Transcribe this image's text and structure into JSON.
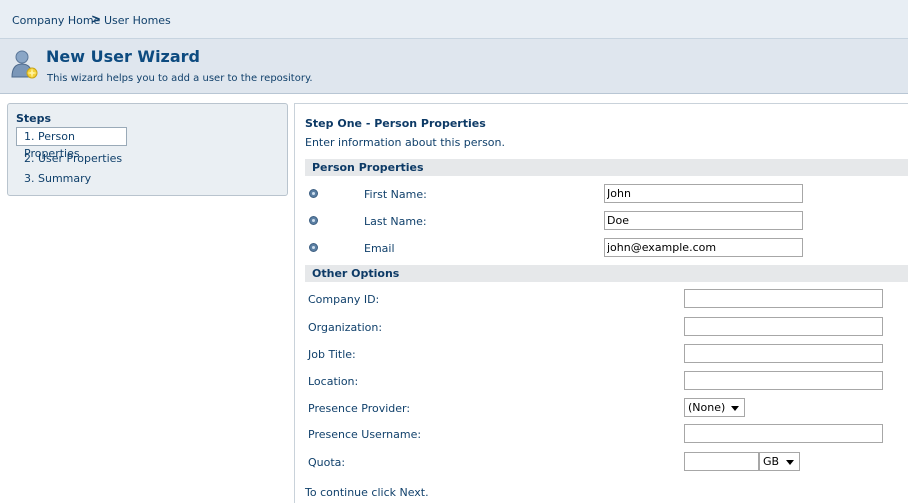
{
  "breadcrumb": {
    "home": "Company Home",
    "separator": ">",
    "current": "User Homes"
  },
  "header": {
    "title": "New User Wizard",
    "subtitle": "This wizard helps you to add a user to the repository."
  },
  "sidebar": {
    "title": "Steps",
    "items": [
      {
        "label": "1. Person Properties"
      },
      {
        "label": "2. User Properties"
      },
      {
        "label": "3. Summary"
      }
    ]
  },
  "main": {
    "step_title": "Step One - Person Properties",
    "step_desc": "Enter information about this person.",
    "person_section": "Person Properties",
    "first_name_label": "First Name:",
    "first_name_value": "John",
    "last_name_label": "Last Name:",
    "last_name_value": "Doe",
    "email_label": "Email",
    "email_value": "john@example.com",
    "other_section": "Other Options",
    "company_id_label": "Company ID:",
    "organization_label": "Organization:",
    "job_title_label": "Job Title:",
    "location_label": "Location:",
    "presence_provider_label": "Presence Provider:",
    "presence_provider_value": "(None)",
    "presence_username_label": "Presence Username:",
    "quota_label": "Quota:",
    "quota_unit": "GB",
    "footer": "To continue click Next."
  }
}
